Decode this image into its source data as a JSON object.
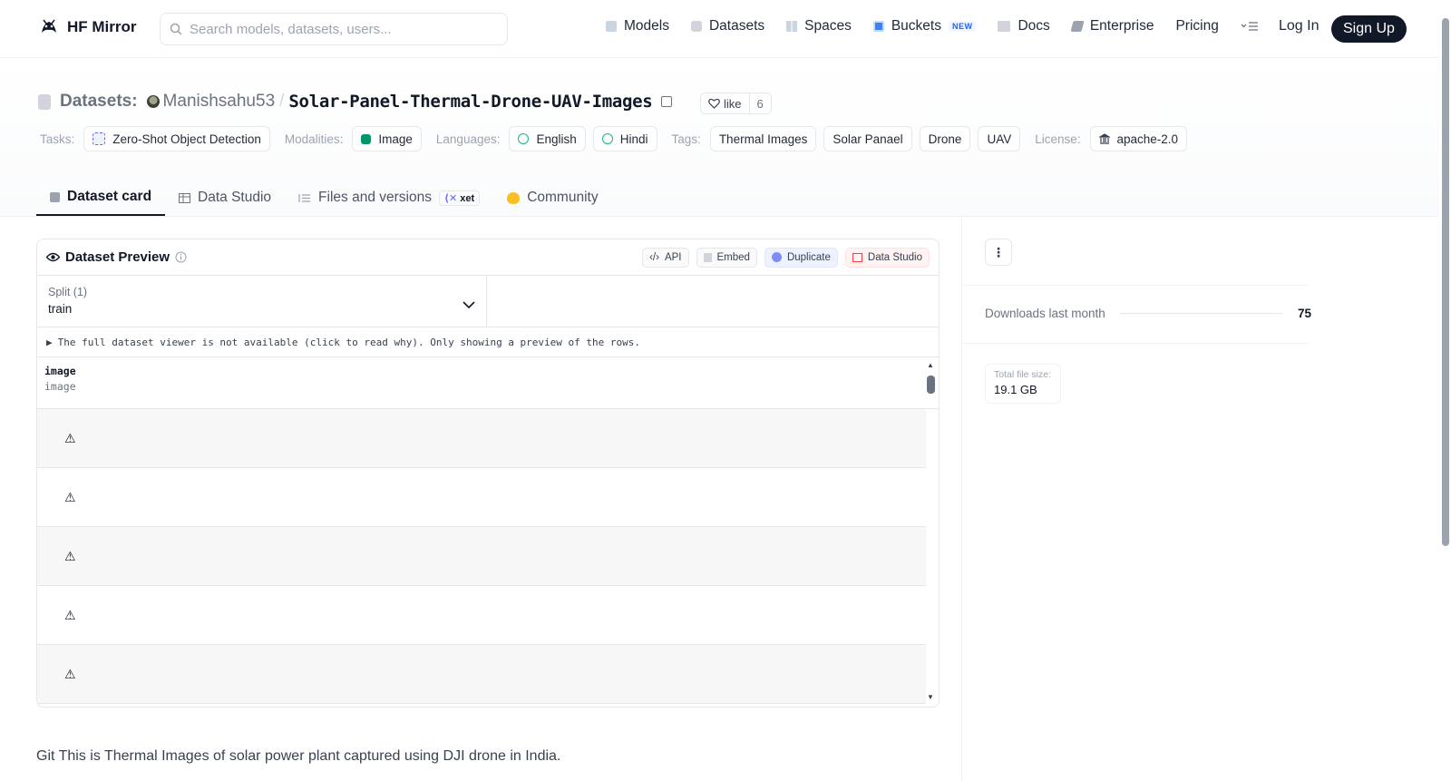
{
  "nav": {
    "brand": "HF Mirror",
    "search_placeholder": "Search models, datasets, users...",
    "links": [
      {
        "label": "Models",
        "icon": "cube-icon"
      },
      {
        "label": "Datasets",
        "icon": "database-icon"
      },
      {
        "label": "Spaces",
        "icon": "grid-icon"
      },
      {
        "label": "Buckets",
        "icon": "bucket-icon",
        "badge": "NEW"
      },
      {
        "label": "Docs",
        "icon": "book-icon"
      },
      {
        "label": "Enterprise",
        "icon": "enterprise-icon"
      },
      {
        "label": "Pricing"
      }
    ],
    "login": "Log In",
    "signup": "Sign Up"
  },
  "header": {
    "section_label": "Datasets:",
    "owner": "Manishsahu53",
    "separator": "/",
    "repo": "Solar-Panel-Thermal-Drone-UAV-Images",
    "like_label": "like",
    "like_count": "6"
  },
  "tags": {
    "tasks_label": "Tasks:",
    "task": "Zero-Shot Object Detection",
    "modalities_label": "Modalities:",
    "modality": "Image",
    "languages_label": "Languages:",
    "languages": [
      "English",
      "Hindi"
    ],
    "tags_label": "Tags:",
    "tags": [
      "Thermal Images",
      "Solar Panael",
      "Drone",
      "UAV"
    ],
    "license_label": "License:",
    "license": "apache-2.0"
  },
  "tabs": [
    {
      "label": "Dataset card",
      "active": true
    },
    {
      "label": "Data Studio"
    },
    {
      "label": "Files and versions",
      "badge": "xet"
    },
    {
      "label": "Community"
    }
  ],
  "preview": {
    "title": "Dataset Preview",
    "actions": [
      "API",
      "Embed",
      "Duplicate",
      "Data Studio"
    ],
    "split_label": "Split (1)",
    "split_value": "train",
    "notice": "The full dataset viewer is not available (click to read why). Only showing a preview of the rows.",
    "column_name": "image",
    "column_type": "image",
    "row_count_visible": 5
  },
  "readme": {
    "text": "Git This is Thermal Images of solar power plant captured using DJI drone in India."
  },
  "sidebar": {
    "downloads_label": "Downloads last month",
    "downloads_value": "75",
    "file_size_label": "Total file size:",
    "file_size_value": "19.1 GB"
  },
  "colors": {
    "primary_dark": "#111827",
    "muted": "#6b7280",
    "border": "#e5e7eb",
    "badge_blue": "#2563eb"
  }
}
